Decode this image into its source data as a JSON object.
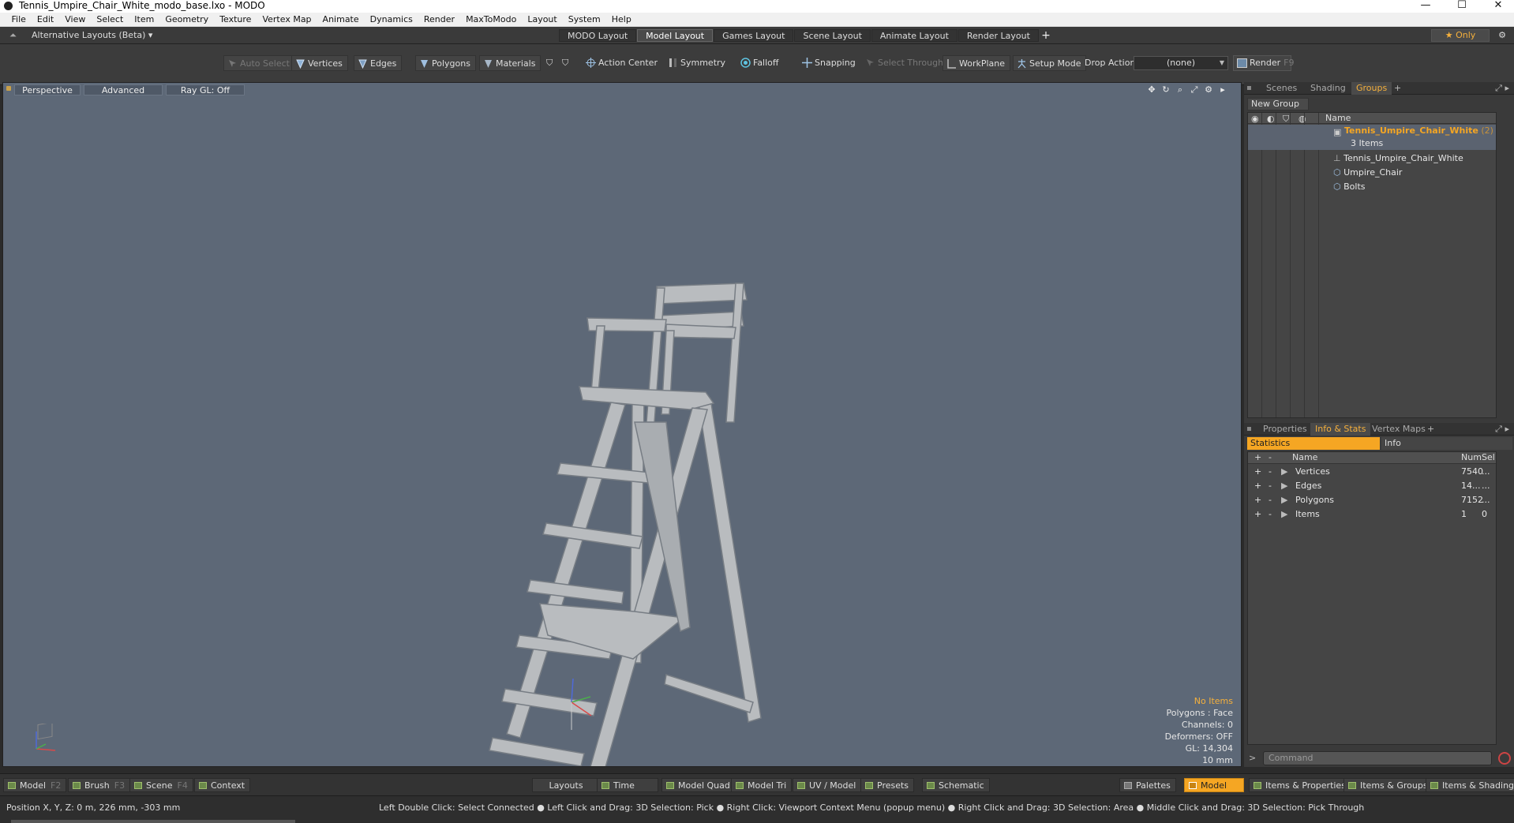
{
  "window": {
    "title": "Tennis_Umpire_Chair_White_modo_base.lxo - MODO",
    "minimize": "—",
    "maximize": "☐",
    "close": "✕"
  },
  "menu": [
    "File",
    "Edit",
    "View",
    "Select",
    "Item",
    "Geometry",
    "Texture",
    "Vertex Map",
    "Animate",
    "Dynamics",
    "Render",
    "MaxToModo",
    "Layout",
    "System",
    "Help"
  ],
  "layouts": {
    "alternative": "Alternative Layouts (Beta) ▾",
    "tabs": [
      "MODO Layout",
      "Model Layout",
      "Games Layout",
      "Scene Layout",
      "Animate Layout",
      "Render Layout"
    ],
    "active": "Model Layout",
    "only": "★  Only"
  },
  "toolbar": {
    "auto_select": "Auto Select",
    "vertices": "Vertices",
    "edges": "Edges",
    "polygons": "Polygons",
    "materials": "Materials",
    "action_center": "Action Center",
    "symmetry": "Symmetry",
    "falloff": "Falloff",
    "snapping": "Snapping",
    "select_through": "Select Through",
    "workplane": "WorkPlane",
    "setup_mode": "Setup Mode",
    "drop_action_label": "Drop Action",
    "drop_action_value": "(none)",
    "render": "Render",
    "render_key": "F9"
  },
  "viewport": {
    "view": "Perspective",
    "shading": "Advanced",
    "raygl": "Ray GL: Off",
    "info": {
      "items": "No Items",
      "polygons": "Polygons : Face",
      "channels": "Channels: 0",
      "deformers": "Deformers: OFF",
      "gl": "GL: 14,304",
      "scale": "10 mm"
    }
  },
  "scene_panel": {
    "tabs": [
      "Scenes",
      "Shading",
      "Groups"
    ],
    "active": "Groups",
    "new_group": "New Group",
    "name_header": "Name",
    "group": {
      "name": "Tennis_Umpire_Chair_White",
      "count": "(2)",
      "items_label": "3 Items",
      "children": [
        "Tennis_Umpire_Chair_White",
        "Umpire_Chair",
        "Bolts"
      ]
    }
  },
  "stats_panel": {
    "tabs": [
      "Properties",
      "Info & Stats",
      "Vertex Maps"
    ],
    "active": "Info & Stats",
    "statistics": "Statistics",
    "info": "Info",
    "headers": {
      "name": "Name",
      "num": "Num",
      "sel": "Sel"
    },
    "rows": [
      {
        "name": "Vertices",
        "num": "7540",
        "sel": "..."
      },
      {
        "name": "Edges",
        "num": "14...",
        "sel": "..."
      },
      {
        "name": "Polygons",
        "num": "7152",
        "sel": "..."
      },
      {
        "name": "Items",
        "num": "1",
        "sel": "0"
      }
    ],
    "command_placeholder": "Command"
  },
  "bottombar": {
    "model": "Model",
    "model_key": "F2",
    "brush": "Brush",
    "brush_key": "F3",
    "scene": "Scene",
    "scene_key": "F4",
    "context": "Context",
    "layouts": "Layouts",
    "time": "Time",
    "model_quad": "Model Quad",
    "model_tri": "Model Tri",
    "uv_model": "UV / Model",
    "presets": "Presets",
    "schematic": "Schematic",
    "palettes": "Palettes",
    "model_active": "Model",
    "items_properties": "Items & Properties",
    "items_groups": "Items & Groups",
    "items_shading": "Items & Shading"
  },
  "status": {
    "position": "Position X, Y, Z:   0 m, 226 mm, -303 mm",
    "hints": "Left Double Click: Select Connected ● Left Click and Drag: 3D Selection: Pick ● Right Click: Viewport Context Menu (popup menu) ● Right Click and Drag: 3D Selection: Area ● Middle Click and Drag: 3D Selection: Pick Through"
  },
  "colors": {
    "accent": "#f5a623",
    "viewport_bg": "#5d6877",
    "panel_bg": "#3a3a3a"
  }
}
